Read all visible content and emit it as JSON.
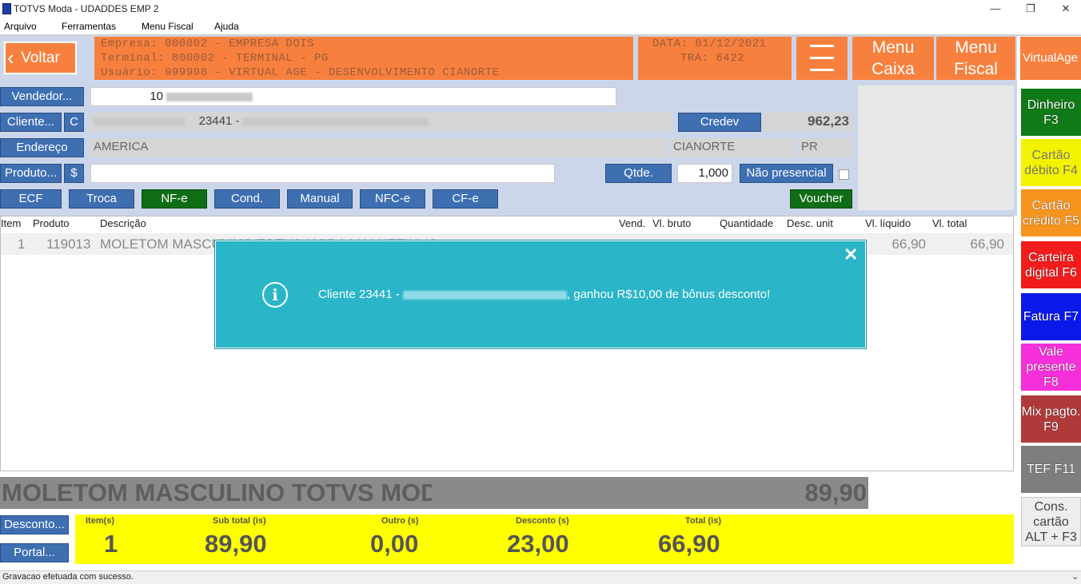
{
  "window": {
    "title": "TOTVS Moda - UDADDES EMP 2",
    "min": "—",
    "max": "❐",
    "close": "✕"
  },
  "menu": [
    "Arquivo",
    "Ferramentas",
    "Menu Fiscal",
    "Ajuda"
  ],
  "header": {
    "back": "Voltar",
    "empresa": "Empresa: 000002 - EMPRESA DOIS",
    "terminal": "Terminal: 000002 - TERMINAL - PG",
    "usuario": "Usuário: 999998 - VIRTUAL AGE - DESENVOLVIMENTO CIANORTE",
    "data": "DATA: 01/12/2021",
    "tra": "TRA: 6422",
    "menu_caixa": [
      "Menu",
      "Caixa"
    ],
    "menu_fiscal": [
      "Menu",
      "Fiscal"
    ],
    "virtual": "VirtualAge"
  },
  "form": {
    "vendedor": "Vendedor...",
    "vendedor_code": "10",
    "cliente": "Cliente...",
    "c": "C",
    "cliente_code": "23441 -",
    "credev": "Credev",
    "credev_value": "962,23",
    "endereco": "Endereço",
    "endereco_value": "AMERICA",
    "cidade": "CIANORTE",
    "uf": "PR",
    "produto": "Produto...",
    "dollar": "$",
    "qtde": "Qtde.",
    "qtde_value": "1,000",
    "nao_presencial": "Não presencial",
    "buttons": [
      "ECF",
      "Troca",
      "NF-e",
      "Cond.",
      "Manual",
      "NFC-e",
      "CF-e"
    ],
    "voucher": "Voucher"
  },
  "grid": {
    "headers": [
      "Item",
      "Produto",
      "Descrição",
      "Vend.",
      "Vl. bruto",
      "Quantidade",
      "Desc. unit",
      "Vl. líquido",
      "Vl. total"
    ],
    "row": {
      "item": "1",
      "produto": "119013",
      "descricao": "MOLETOM MASCULINO TOTVS MODA MALHETINHO",
      "vl_liquido": "66,90",
      "vl_total": "66,90"
    }
  },
  "banner": {
    "product": "MOLETOM MASCULINO TOTVS MODA",
    "price": "89,90"
  },
  "bottom": {
    "desconto": "Desconto...",
    "portal": "Portal..."
  },
  "totals": {
    "labels": [
      "Item(s)",
      "Sub total (is)",
      "Outro (s)",
      "Desconto (s)",
      "Total (is)"
    ],
    "values": [
      "1",
      "89,90",
      "0,00",
      "23,00",
      "66,90"
    ]
  },
  "fkeys": [
    {
      "label": "Dinheiro F3",
      "color": "#0f7a17"
    },
    {
      "label": "Cartão débito F4",
      "color": "#f3f300"
    },
    {
      "label": "Cartão crédito F5",
      "color": "#f7941d"
    },
    {
      "label": "Carteira digital F6",
      "color": "#f21c1c"
    },
    {
      "label": "Fatura F7",
      "color": "#0a18e8"
    },
    {
      "label": "Vale presente F8",
      "color": "#f52fd9"
    },
    {
      "label": "Mix pagto. F9",
      "color": "#b03a3a"
    },
    {
      "label": "TEF F11",
      "color": "#7e7e7e"
    },
    {
      "label": "Cons. cartão ALT + F3",
      "color": "#ededed"
    }
  ],
  "toast": {
    "icon": "info-icon",
    "prefix": "Cliente 23441 - ",
    "suffix": ", ganhou R$10,00 de bônus desconto!",
    "close": "✕"
  },
  "status": "Gravacao efetuada com sucesso."
}
